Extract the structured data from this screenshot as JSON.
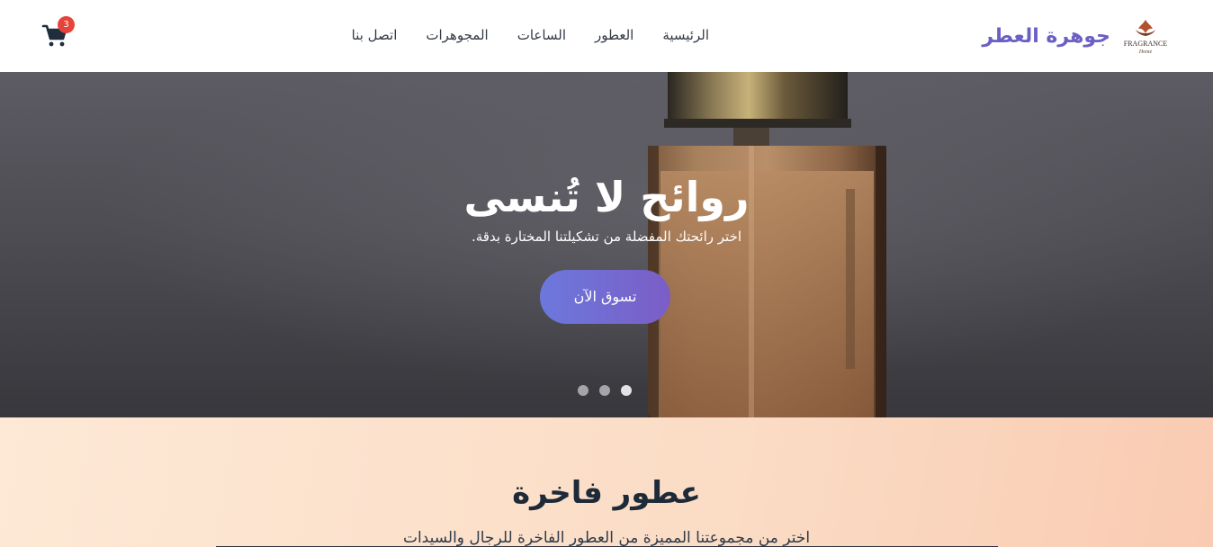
{
  "brand": {
    "name": "جوهرة العطر",
    "logo_text": "FRAGRANCE",
    "logo_script": "Home"
  },
  "nav": {
    "items": [
      {
        "label": "الرئيسية"
      },
      {
        "label": "العطور"
      },
      {
        "label": "الساعات"
      },
      {
        "label": "المجوهرات"
      },
      {
        "label": "اتصل بنا"
      }
    ]
  },
  "cart": {
    "icon": "cart-icon",
    "count": "3"
  },
  "hero": {
    "title": "روائح لا تُنسى",
    "subtitle": "اختر رائحتك المفضلة من تشكيلتنا المختارة بدقة.",
    "cta_label": "تسوق الآن",
    "slides": 3,
    "active_slide": 3
  },
  "featured": {
    "title": "عطور فاخرة",
    "subtitle": "اختر من مجموعتنا المميزة من العطور الفاخرة للرجال والسيدات"
  },
  "colors": {
    "brand": "#6a5fc4",
    "badge": "#e5443b",
    "cta_start": "#6c78dc",
    "cta_end": "#7a5ec6"
  }
}
